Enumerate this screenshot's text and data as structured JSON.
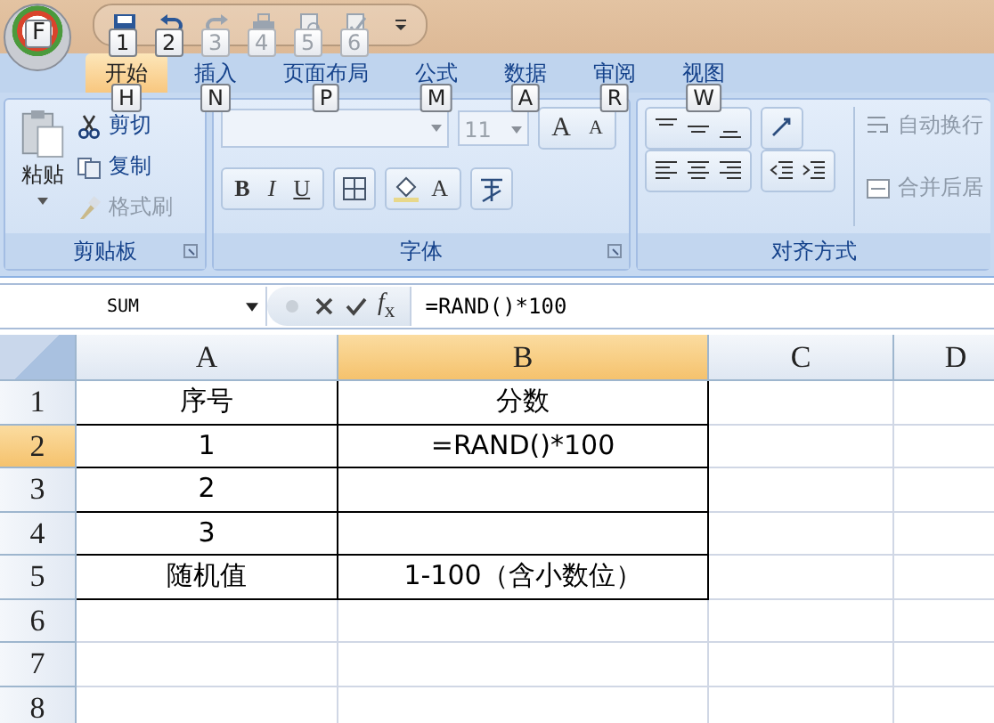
{
  "office_button": {
    "keytip": "F"
  },
  "quick_access": [
    {
      "kind": "save",
      "keytip": "1",
      "disabled": false
    },
    {
      "kind": "undo",
      "keytip": "2",
      "disabled": false
    },
    {
      "kind": "redo",
      "keytip": "3",
      "disabled": true
    },
    {
      "kind": "print",
      "keytip": "4",
      "disabled": true
    },
    {
      "kind": "preview",
      "keytip": "5",
      "disabled": true
    },
    {
      "kind": "spelling",
      "keytip": "6",
      "disabled": true
    }
  ],
  "tabs": [
    {
      "label": "开始",
      "keytip": "H",
      "selected": true
    },
    {
      "label": "插入",
      "keytip": "N",
      "selected": false
    },
    {
      "label": "页面布局",
      "keytip": "P",
      "selected": false
    },
    {
      "label": "公式",
      "keytip": "M",
      "selected": false
    },
    {
      "label": "数据",
      "keytip": "A",
      "selected": false
    },
    {
      "label": "审阅",
      "keytip": "R",
      "selected": false
    },
    {
      "label": "视图",
      "keytip": "W",
      "selected": false
    }
  ],
  "ribbon": {
    "clipboard": {
      "title": "剪贴板",
      "paste": "粘贴",
      "items": [
        {
          "kind": "cut",
          "label": "剪切",
          "disabled": false
        },
        {
          "kind": "copy",
          "label": "复制",
          "disabled": false
        },
        {
          "kind": "painter",
          "label": "格式刷",
          "disabled": true
        }
      ]
    },
    "font": {
      "title": "字体",
      "size": "11",
      "grow": "A",
      "shrink": "A",
      "styles": [
        "B",
        "I",
        "U"
      ],
      "color_letter": "A"
    },
    "alignment": {
      "title": "对齐方式",
      "wrap": "自动换行",
      "merge": "合并后居"
    }
  },
  "formula_bar": {
    "name_box": "SUM",
    "insert_function": "*f*$_{x}$",
    "formula": "=RAND()*100"
  },
  "sheet": {
    "columns": [
      {
        "label": "A",
        "selected": false
      },
      {
        "label": "B",
        "selected": true
      },
      {
        "label": "C",
        "selected": false
      },
      {
        "label": "D",
        "selected": false
      }
    ],
    "rows": [
      {
        "label": "1",
        "selected": false,
        "cells": [
          "序号",
          "分数"
        ]
      },
      {
        "label": "2",
        "selected": true,
        "cells": [
          "1",
          "=RAND()*100"
        ]
      },
      {
        "label": "3",
        "selected": false,
        "cells": [
          "2"
        ]
      },
      {
        "label": "4",
        "selected": false,
        "cells": [
          "3"
        ]
      },
      {
        "label": "5",
        "selected": false,
        "cells": [
          "随机值",
          "1-100（含小数位）"
        ]
      },
      {
        "label": "6",
        "selected": false
      },
      {
        "label": "7",
        "selected": false
      },
      {
        "label": "8",
        "selected": false
      }
    ]
  }
}
